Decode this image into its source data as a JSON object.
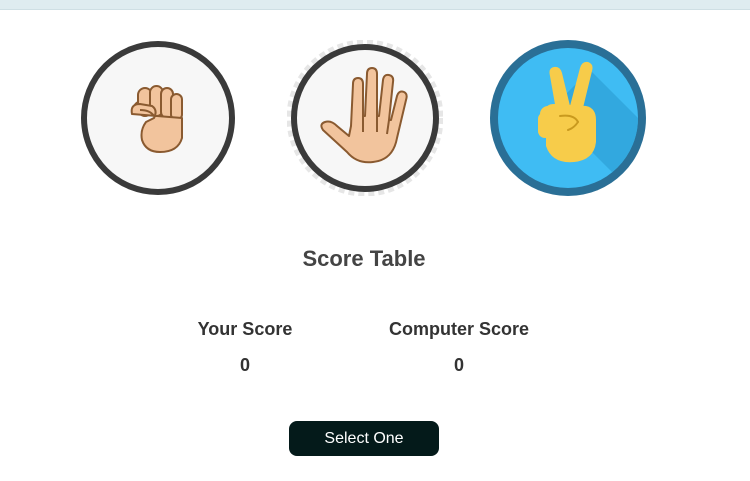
{
  "choices": [
    {
      "name": "rock",
      "icon": "rock-fist-icon",
      "selected": false
    },
    {
      "name": "paper",
      "icon": "paper-hand-icon",
      "selected": false
    },
    {
      "name": "scissors",
      "icon": "scissors-victory-hand-icon",
      "selected": true
    }
  ],
  "score_table": {
    "title": "Score Table",
    "your_label": "Your Score",
    "your_value": "0",
    "computer_label": "Computer Score",
    "computer_value": "0"
  },
  "select_button": {
    "label": "Select One"
  },
  "colors": {
    "ring": "#3a3a3a",
    "skin": "#f2c49d",
    "skin_outline": "#8a5a30",
    "selected_bg": "#3fbcf3",
    "selected_ring": "#2a6f96",
    "emoji_yellow": "#f7cc4a",
    "button_bg": "#041a1a",
    "topbar": "#dfecf0"
  }
}
